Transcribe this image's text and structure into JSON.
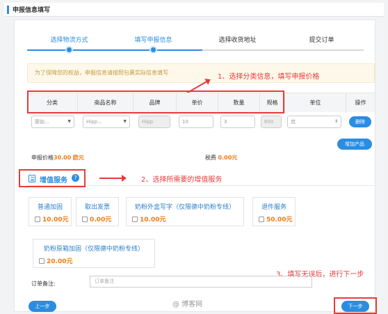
{
  "header": {
    "title": "申报信息填写"
  },
  "steps": [
    {
      "label": "选择物流方式"
    },
    {
      "label": "填写申报信息"
    },
    {
      "label": "选择收货地址"
    },
    {
      "label": "提交订单"
    }
  ],
  "notice": "为了保障您的权益，申报信息请按照包裹实际信息填写",
  "annotations": {
    "a1": "1、选择分类信息，填写申报价格",
    "a2": "2、选择所需要的增值服务",
    "a3": "3、填写无误后，进行下一步"
  },
  "table": {
    "headers": [
      "分类",
      "商品名称",
      "品牌",
      "单价",
      "数量",
      "规格",
      "单位",
      "操作"
    ],
    "row": {
      "category": "婴幼...",
      "product": "Hipp...",
      "brand": "Hipp",
      "price": "10",
      "qty": "3",
      "spec": "600",
      "unit": "克",
      "delete": "删除"
    }
  },
  "add_product": "增加产品",
  "totals": {
    "declare_label": "申报价格",
    "declare_value": "30.00",
    "declare_unit": "欧元",
    "tax_label": "税费",
    "tax_value": "0.00元"
  },
  "vas": {
    "title": "增值服务",
    "help": "?",
    "items": [
      {
        "name": "普通加固",
        "price": "10.00元"
      },
      {
        "name": "取出发票",
        "price": "0.00元"
      },
      {
        "name": "奶粉外盒写字（仅限德中奶粉专线）",
        "price": "10.00元"
      },
      {
        "name": "退件服务",
        "price": "50.00元"
      },
      {
        "name": "奶粉原箱加固（仅限德中奶粉专线）",
        "price": "20.00元"
      }
    ]
  },
  "remark": {
    "label": "订单备注:",
    "placeholder": "订单备注"
  },
  "buttons": {
    "prev": "上一步",
    "next": "下一步"
  },
  "watermark": "@ 博客网",
  "colors": {
    "accent": "#2b8de0",
    "annotation": "#e83a3a",
    "price": "#f07a14"
  }
}
